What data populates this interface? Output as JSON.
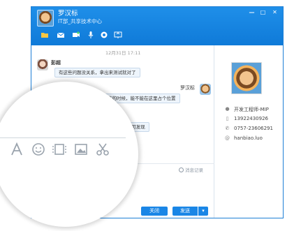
{
  "window": {
    "contact_name": "罗汉标",
    "department": "IT部_共享技术中心"
  },
  "toolbar": {
    "icons": [
      "folder-icon",
      "mail-icon",
      "video-icon",
      "mic-icon",
      "settings-icon",
      "screen-icon"
    ]
  },
  "chat": {
    "date_time": "12月31日  17:11",
    "messages": [
      {
        "sender": "彭超",
        "text": "有这些问题没关系，拿出来测试就对了"
      },
      {
        "sender": "罗汉标",
        "text": "主画板出来的时候，能不能在这里占个位置"
      }
    ],
    "partial_reply": "个框    可发现",
    "history_label": "消息记录"
  },
  "buttons": {
    "close": "关闭",
    "send": "发送",
    "send_dropdown": "▾"
  },
  "profile": {
    "title": "开发工程师-MIP",
    "mobile": "13922430926",
    "phone": "0757-23606291",
    "email": "hanbiao.luo"
  },
  "magnifier": {
    "toolbar_icons": [
      "font-icon",
      "emoji-icon",
      "screenshot-icon",
      "image-icon",
      "cut-icon"
    ]
  },
  "colors": {
    "titlebar_blue": "#1a86e6",
    "accent_button": "#1a86e6",
    "bubble_bg": "#eef5fc"
  }
}
